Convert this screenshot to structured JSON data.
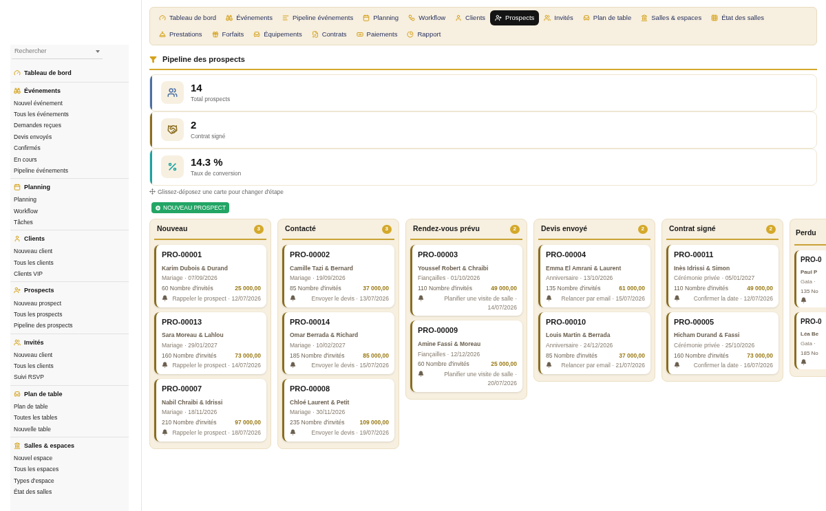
{
  "sidebar": {
    "search": {
      "placeholder": "Rechercher"
    },
    "sections": [
      {
        "title": "Tableau de bord"
      },
      {
        "title": "Événements",
        "items": [
          "Nouvel événement",
          "Tous les événements",
          "Demandes reçues",
          "Devis envoyés",
          "Confirmés",
          "En cours",
          "Pipeline événements"
        ]
      },
      {
        "title": "Planning",
        "items": [
          "Planning",
          "Workflow",
          "Tâches"
        ]
      },
      {
        "title": "Clients",
        "items": [
          "Nouveau client",
          "Tous les clients",
          "Clients VIP"
        ]
      },
      {
        "title": "Prospects",
        "items": [
          "Nouveau prospect",
          "Tous les prospects",
          "Pipeline des prospects"
        ]
      },
      {
        "title": "Invités",
        "items": [
          "Nouveau client",
          "Tous les clients",
          "Suivi RSVP"
        ]
      },
      {
        "title": "Plan de table",
        "items": [
          "Plan de table",
          "Toutes les tables",
          "Nouvelle table"
        ]
      },
      {
        "title": "Salles & espaces",
        "items": [
          "Nouvel espace",
          "Tous les espaces",
          "Types d'espace",
          "État des salles"
        ]
      }
    ]
  },
  "nav": [
    {
      "label": "Tableau de bord",
      "selected": false
    },
    {
      "label": "Événements",
      "selected": false
    },
    {
      "label": "Pipeline événements",
      "selected": false
    },
    {
      "label": "Planning",
      "selected": false
    },
    {
      "label": "Workflow",
      "selected": false
    },
    {
      "label": "Clients",
      "selected": false
    },
    {
      "label": "Prospects",
      "selected": true
    },
    {
      "label": "Invités",
      "selected": false
    },
    {
      "label": "Plan de table",
      "selected": false
    },
    {
      "label": "Salles & espaces",
      "selected": false
    },
    {
      "label": "État des salles",
      "selected": false
    },
    {
      "label": "Prestations",
      "selected": false
    },
    {
      "label": "Forfaits",
      "selected": false
    },
    {
      "label": "Équipements",
      "selected": false
    },
    {
      "label": "Contrats",
      "selected": false
    },
    {
      "label": "Paiements",
      "selected": false
    },
    {
      "label": "Rapport",
      "selected": false
    }
  ],
  "page_title": "Pipeline des prospects",
  "stats": [
    {
      "value": "14",
      "label": "Total prospects",
      "color": "#4a6fa5"
    },
    {
      "value": "2",
      "label": "Contrat signé",
      "color": "#8a6d1f"
    },
    {
      "value": "14.3 %",
      "label": "Taux de conversion",
      "color": "#1aa3a3"
    }
  ],
  "hint": "Glissez-déposez une carte pour changer d'étape",
  "new_button": "NOUVEAU PROSPECT",
  "columns": [
    {
      "title": "Nouveau",
      "count": "3",
      "cards": [
        {
          "ref": "PRO-00001",
          "name": "Karim Dubois & Durand",
          "event": "Mariage · 07/09/2026",
          "guests": "60 Nombre d'invités",
          "amount": "25 000,00",
          "reminder": "Rappeler le prospect · 12/07/2026"
        },
        {
          "ref": "PRO-00013",
          "name": "Sara Moreau & Lahlou",
          "event": "Mariage · 29/01/2027",
          "guests": "160 Nombre d'invités",
          "amount": "73 000,00",
          "reminder": "Rappeler le prospect · 14/07/2026"
        },
        {
          "ref": "PRO-00007",
          "name": "Nabil Chraibi & Idrissi",
          "event": "Mariage · 18/11/2026",
          "guests": "210 Nombre d'invités",
          "amount": "97 000,00",
          "reminder": "Rappeler le prospect · 18/07/2026"
        }
      ]
    },
    {
      "title": "Contacté",
      "count": "3",
      "cards": [
        {
          "ref": "PRO-00002",
          "name": "Camille Tazi & Bernard",
          "event": "Mariage · 19/09/2026",
          "guests": "85 Nombre d'invités",
          "amount": "37 000,00",
          "reminder": "Envoyer le devis · 13/07/2026"
        },
        {
          "ref": "PRO-00014",
          "name": "Omar Berrada & Richard",
          "event": "Mariage · 10/02/2027",
          "guests": "185 Nombre d'invités",
          "amount": "85 000,00",
          "reminder": "Envoyer le devis · 15/07/2026"
        },
        {
          "ref": "PRO-00008",
          "name": "Chloé Laurent & Petit",
          "event": "Mariage · 30/11/2026",
          "guests": "235 Nombre d'invités",
          "amount": "109 000,00",
          "reminder": "Envoyer le devis · 19/07/2026"
        }
      ]
    },
    {
      "title": "Rendez-vous prévu",
      "count": "2",
      "cards": [
        {
          "ref": "PRO-00003",
          "name": "Youssef Robert & Chraibi",
          "event": "Fiançailles · 01/10/2026",
          "guests": "110 Nombre d'invités",
          "amount": "49 000,00",
          "reminder": "Planifier une visite de salle · 14/07/2026"
        },
        {
          "ref": "PRO-00009",
          "name": "Amine Fassi & Moreau",
          "event": "Fiançailles · 12/12/2026",
          "guests": "60 Nombre d'invités",
          "amount": "25 000,00",
          "reminder": "Planifier une visite de salle · 20/07/2026"
        }
      ]
    },
    {
      "title": "Devis envoyé",
      "count": "2",
      "cards": [
        {
          "ref": "PRO-00004",
          "name": "Emma El Amrani & Laurent",
          "event": "Anniversaire · 13/10/2026",
          "guests": "135 Nombre d'invités",
          "amount": "61 000,00",
          "reminder": "Relancer par email · 15/07/2026"
        },
        {
          "ref": "PRO-00010",
          "name": "Louis Martin & Berrada",
          "event": "Anniversaire · 24/12/2026",
          "guests": "85 Nombre d'invités",
          "amount": "37 000,00",
          "reminder": "Relancer par email · 21/07/2026"
        }
      ]
    },
    {
      "title": "Contrat signé",
      "count": "2",
      "cards": [
        {
          "ref": "PRO-00011",
          "name": "Inès Idrissi & Simon",
          "event": "Cérémonie privée · 05/01/2027",
          "guests": "110 Nombre d'invités",
          "amount": "49 000,00",
          "reminder": "Confirmer la date · 12/07/2026"
        },
        {
          "ref": "PRO-00005",
          "name": "Hicham Durand & Fassi",
          "event": "Cérémonie privée · 25/10/2026",
          "guests": "160 Nombre d'invités",
          "amount": "73 000,00",
          "reminder": "Confirmer la date · 16/07/2026"
        }
      ]
    }
  ],
  "partial_column": {
    "title": "Perdu",
    "cards": [
      {
        "ref": "PRO-0",
        "name": "Paul P",
        "event": "Gala ·",
        "guests": "135 No"
      },
      {
        "ref": "PRO-0",
        "name": "Léa Be",
        "event": "Gala ·",
        "guests": "185 No"
      }
    ]
  }
}
